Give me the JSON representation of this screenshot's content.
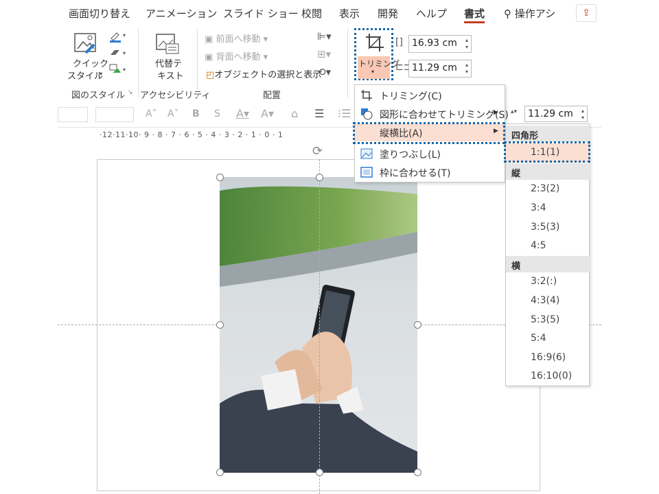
{
  "tabs": [
    "画面切り替え",
    "アニメーション",
    "スライド ショー",
    "校閲",
    "表示",
    "開発",
    "ヘルプ",
    "書式"
  ],
  "tell_me": "操作アシ",
  "ribbon": {
    "quick_style": "クイック",
    "quick_style2": "スタイル",
    "alt_text": "代替テ",
    "alt_text2": "キスト",
    "bring_forward": "前面へ移動",
    "send_backward": "背面へ移動",
    "selection_pane": "オブジェクトの選択と表示",
    "trim": "トリミング",
    "width": "16.93 cm",
    "height": "11.29 cm",
    "group_styles": "図のスタイル",
    "group_access": "アクセシビリティ",
    "group_arrange": "配置"
  },
  "toolbar2": {
    "height": "11.29 cm"
  },
  "ruler": "·12·11·10· 9 · 8 · 7 · 6 · 5 · 4 · 3 · 2 · 1 · 0 · 1",
  "menu": {
    "items": [
      "トリミング(C)",
      "図形に合わせてトリミング(S)",
      "縦横比(A)",
      "塗りつぶし(L)",
      "枠に合わせる(T)"
    ]
  },
  "submenu": {
    "square_header": "四角形",
    "square": [
      "1:1(1)"
    ],
    "portrait_header": "縦",
    "portrait": [
      "2:3(2)",
      "3:4",
      "3:5(3)",
      "4:5"
    ],
    "landscape_header": "横",
    "landscape": [
      "3:2(:)",
      "4:3(4)",
      "5:3(5)",
      "5:4",
      "16:9(6)",
      "16:10(0)"
    ]
  }
}
